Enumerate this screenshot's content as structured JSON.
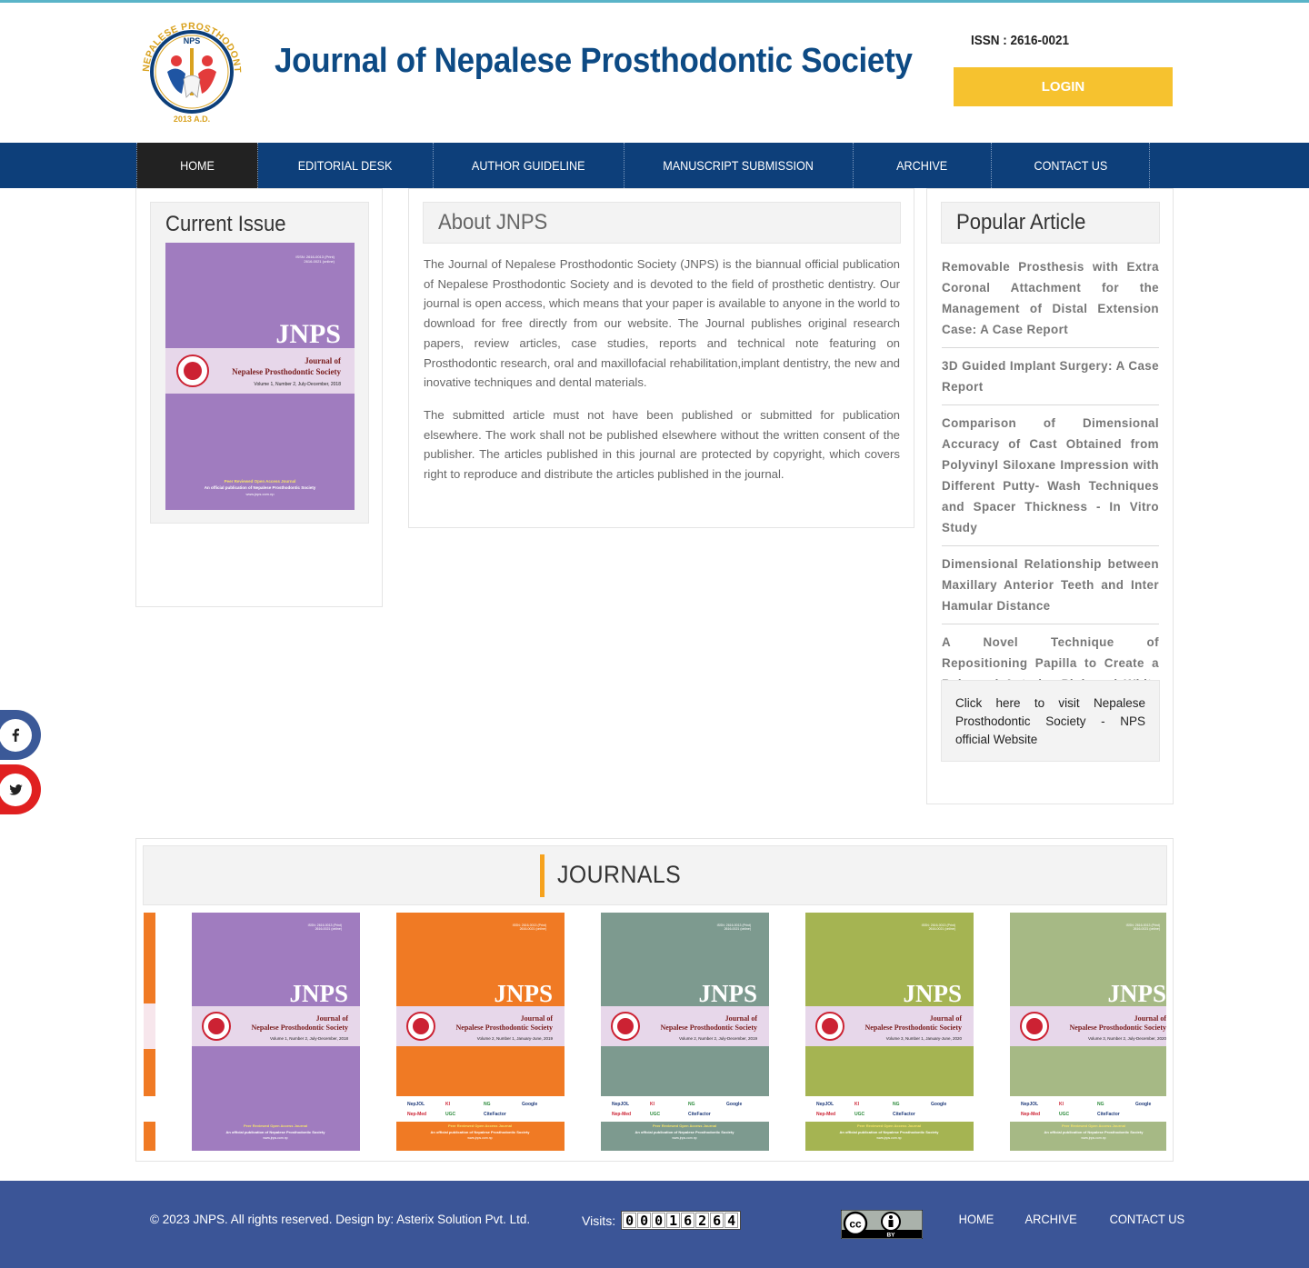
{
  "header": {
    "title": "Journal of Nepalese Prosthodontic Society",
    "issn": "ISSN : 2616-0021",
    "login_label": "LOGIN",
    "logo": {
      "ring_text": "NEPALESE PROSTHODONTIC SOCIETY",
      "top_text": "NPS",
      "year": "2013 A.D."
    }
  },
  "nav": {
    "items": [
      {
        "label": "HOME",
        "active": true
      },
      {
        "label": "EDITORIAL DESK"
      },
      {
        "label": "AUTHOR GUIDELINE"
      },
      {
        "label": "MANUSCRIPT SUBMISSION"
      },
      {
        "label": "ARCHIVE"
      },
      {
        "label": "CONTACT US"
      }
    ]
  },
  "current_issue": {
    "heading": "Current Issue",
    "cover": {
      "color": "#a07cbf",
      "issn_lines": [
        "ISSN: 2616-0013 (Print)",
        "2616-0021 (online)"
      ],
      "abbr": "JNPS",
      "journal_line1": "Journal of",
      "journal_line2": "Nepalese Prosthodontic Society",
      "volume": "Volume 1, Number 2, July-December, 2018",
      "footer1": "Peer Reviewed Open Access Journal",
      "footer2": "An official publication of Nepalese Prosthodontic Society",
      "footer3": "www.jnps.com.np"
    }
  },
  "about": {
    "heading": "About JNPS",
    "paragraphs": [
      "The Journal of Nepalese Prosthodontic Society (JNPS) is the biannual official publication of Nepalese Prosthodontic Society and is devoted to the field of prosthetic dentistry. Our journal is open access, which means that your paper is available to anyone in the world to download for free directly from our website. The Journal publishes original research papers, review articles, case studies, reports and technical note featuring on Prosthodontic research, oral and maxillofacial rehabilitation,implant dentistry, the new and inovative techniques and dental materials.",
      "The submitted article must not have been published or submitted for publication elsewhere. The work shall not be published elsewhere without the written consent of the publisher. The articles published in this journal are protected by copyright, which covers right to reproduce and distribute the articles published in the journal."
    ]
  },
  "popular": {
    "heading": "Popular Article",
    "items": [
      "Removable Prosthesis with Extra Coronal Attachment for the Management of Distal Extension Case: A Case Report",
      "3D Guided Implant Surgery: A Case Report",
      "Comparison of Dimensional Accuracy of Cast Obtained from Polyvinyl Siloxane Impression with Different Putty- Wash Techniques and Spacer Thickness - In Vitro Study",
      "Dimensional Relationship between Maxillary Anterior Teeth and Inter Hamular Distance",
      "A Novel Technique of Repositioning Papilla to Create a Balanced Anterior Pink and White Esthetics"
    ],
    "nps_link": "Click here to visit Nepalese Prosthodontic Society - NPS official Website"
  },
  "social": {
    "facebook_icon": "facebook-icon",
    "twitter_icon": "twitter-icon"
  },
  "journals": {
    "heading": "JOURNALS",
    "covers": [
      {
        "color": "#a07cbf",
        "volume": "Volume 1, Number 2, July-December, 2018",
        "indexed": false
      },
      {
        "color": "#f07a24",
        "volume": "Volume 2, Number 1, January-June, 2019",
        "indexed": true
      },
      {
        "color": "#7d9a8f",
        "volume": "Volume 2, Number 2, July-December, 2019",
        "indexed": true
      },
      {
        "color": "#a5b452",
        "volume": "Volume 3, Number 1, January-June, 2020",
        "indexed": true
      },
      {
        "color": "#a6b985",
        "volume": "Volume 3, Number 2, July-December, 2020",
        "indexed": true
      }
    ],
    "partial_cover_color": "#f07a24",
    "index_logos": [
      "NepJOL",
      "Kl",
      "NG",
      "Google",
      "Nep-Med",
      "UGC",
      "CiteFactor"
    ]
  },
  "footer": {
    "copyright": "© 2023 JNPS. All rights reserved. Design by: Asterix Solution Pvt. Ltd.",
    "visits_label": "Visits:",
    "visits_count": "00016264",
    "cc_badge": "cc-by-icon",
    "links": [
      "HOME",
      "ARCHIVE",
      "CONTACT US"
    ]
  },
  "colors": {
    "nav_bg": "#0d3f7a",
    "title": "#0d4a84",
    "login": "#f6c22f",
    "footer_bg": "#3b5597",
    "accent_bar": "#f6a21d"
  }
}
